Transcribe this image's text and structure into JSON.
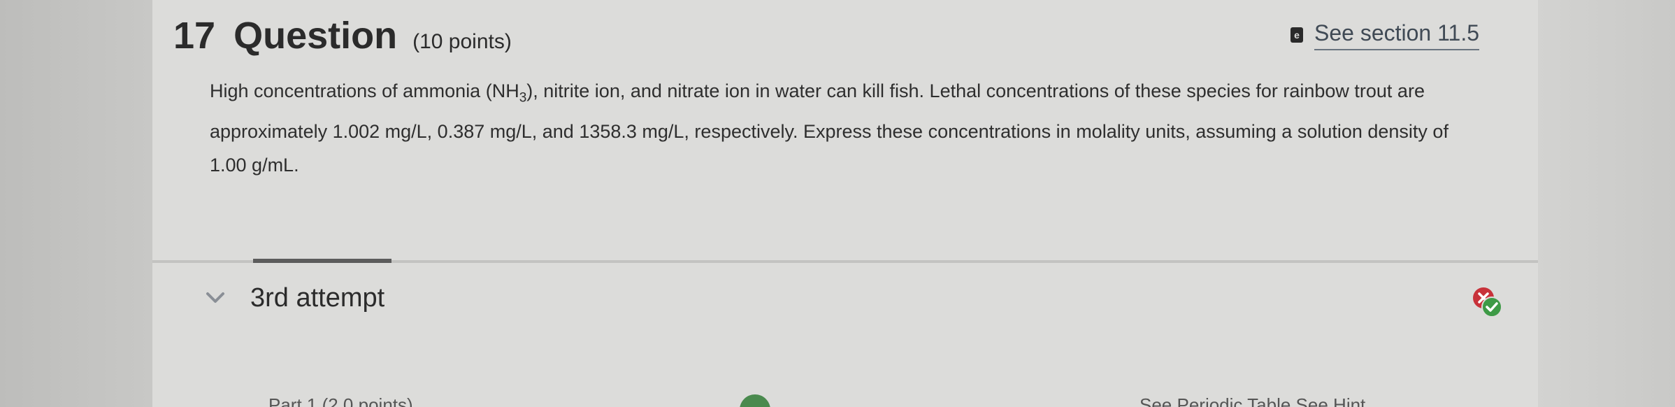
{
  "question": {
    "number": "17",
    "title": "Question",
    "points": "(10 points)",
    "body_lines": [
      "High concentrations of ammonia (NH",
      "), nitrite ion, and nitrate ion in water can kill fish. Lethal concentrations of these species for rainbow trout are",
      "approximately 1.002 mg/L, 0.387 mg/L, and 1358.3 mg/L, respectively. Express these concentrations in molality units, assuming a solution density of",
      "1.00 g/mL."
    ],
    "subscript": "3"
  },
  "section_link": {
    "icon": "ebook-icon",
    "icon_letter": "e",
    "label": "See section 11.5"
  },
  "attempt": {
    "label": "3rd attempt",
    "icon": "chevron-down-icon",
    "status_icons": [
      "incorrect-x-icon",
      "correct-check-icon"
    ]
  },
  "bottom_partial": {
    "left_text": "Part 1 (2.0 points)",
    "right_text": "See Periodic Table   See Hint"
  },
  "colors": {
    "incorrect": "#c8323a",
    "correct": "#3e9a46",
    "link": "#404a55"
  }
}
